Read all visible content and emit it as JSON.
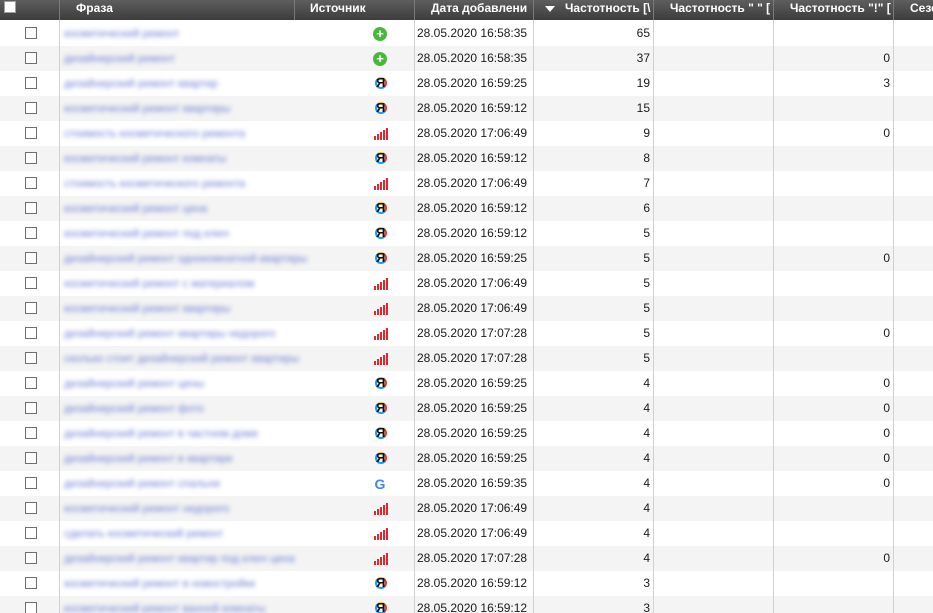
{
  "columns": {
    "phrase": "Фраза",
    "source": "Источник",
    "date_added": "Дата добавлени",
    "freq": "Частотность [\\",
    "freq_quotes": "Частотность \" \" [",
    "freq_excl": "Частотность \"!\" [",
    "season": "Сезо"
  },
  "sort_column": "freq",
  "rows": [
    {
      "phrase": "косметический ремонт",
      "source": "plus-icon",
      "date": "28.05.2020 16:58:35",
      "freq": "65",
      "freq_quotes": "",
      "freq_excl": ""
    },
    {
      "phrase": "дизайнерский ремонт",
      "source": "plus-icon",
      "date": "28.05.2020 16:58:35",
      "freq": "37",
      "freq_quotes": "",
      "freq_excl": "0"
    },
    {
      "phrase": "дизайнерский ремонт квартир",
      "source": "yandex-icon",
      "date": "28.05.2020 16:59:25",
      "freq": "19",
      "freq_quotes": "",
      "freq_excl": "3"
    },
    {
      "phrase": "косметический ремонт квартиры",
      "source": "yandex-icon",
      "date": "28.05.2020 16:59:12",
      "freq": "15",
      "freq_quotes": "",
      "freq_excl": ""
    },
    {
      "phrase": "стоимость косметического ремонта",
      "source": "wordstat-bars-icon",
      "date": "28.05.2020 17:06:49",
      "freq": "9",
      "freq_quotes": "",
      "freq_excl": "0"
    },
    {
      "phrase": "косметический ремонт комнаты",
      "source": "yandex-icon",
      "date": "28.05.2020 16:59:12",
      "freq": "8",
      "freq_quotes": "",
      "freq_excl": ""
    },
    {
      "phrase": "стоимость косметического ремонта",
      "source": "wordstat-bars-icon",
      "date": "28.05.2020 17:06:49",
      "freq": "7",
      "freq_quotes": "",
      "freq_excl": ""
    },
    {
      "phrase": "косметический ремонт цена",
      "source": "yandex-icon",
      "date": "28.05.2020 16:59:12",
      "freq": "6",
      "freq_quotes": "",
      "freq_excl": ""
    },
    {
      "phrase": "косметический ремонт под ключ",
      "source": "yandex-icon",
      "date": "28.05.2020 16:59:12",
      "freq": "5",
      "freq_quotes": "",
      "freq_excl": ""
    },
    {
      "phrase": "дизайнерский ремонт однокомнатной квартиры",
      "source": "yandex-icon",
      "date": "28.05.2020 16:59:25",
      "freq": "5",
      "freq_quotes": "",
      "freq_excl": "0"
    },
    {
      "phrase": "косметический ремонт с материалом",
      "source": "wordstat-bars-icon",
      "date": "28.05.2020 17:06:49",
      "freq": "5",
      "freq_quotes": "",
      "freq_excl": ""
    },
    {
      "phrase": "косметический ремонт квартиры",
      "source": "wordstat-bars-icon",
      "date": "28.05.2020 17:06:49",
      "freq": "5",
      "freq_quotes": "",
      "freq_excl": ""
    },
    {
      "phrase": "дизайнерский ремонт квартиры недорого",
      "source": "wordstat-bars-icon",
      "date": "28.05.2020 17:07:28",
      "freq": "5",
      "freq_quotes": "",
      "freq_excl": "0"
    },
    {
      "phrase": "сколько стоит дизайнерский ремонт квартиры",
      "source": "wordstat-bars-icon",
      "date": "28.05.2020 17:07:28",
      "freq": "5",
      "freq_quotes": "",
      "freq_excl": ""
    },
    {
      "phrase": "дизайнерский ремонт цены",
      "source": "yandex-icon",
      "date": "28.05.2020 16:59:25",
      "freq": "4",
      "freq_quotes": "",
      "freq_excl": "0"
    },
    {
      "phrase": "дизайнерский ремонт фото",
      "source": "yandex-icon",
      "date": "28.05.2020 16:59:25",
      "freq": "4",
      "freq_quotes": "",
      "freq_excl": "0"
    },
    {
      "phrase": "дизайнерский ремонт в частном доме",
      "source": "yandex-icon",
      "date": "28.05.2020 16:59:25",
      "freq": "4",
      "freq_quotes": "",
      "freq_excl": "0"
    },
    {
      "phrase": "дизайнерский ремонт в квартире",
      "source": "yandex-icon",
      "date": "28.05.2020 16:59:25",
      "freq": "4",
      "freq_quotes": "",
      "freq_excl": "0"
    },
    {
      "phrase": "дизайнерский ремонт спальни",
      "source": "google-icon",
      "date": "28.05.2020 16:59:35",
      "freq": "4",
      "freq_quotes": "",
      "freq_excl": "0"
    },
    {
      "phrase": "косметический ремонт недорого",
      "source": "wordstat-bars-icon",
      "date": "28.05.2020 17:06:49",
      "freq": "4",
      "freq_quotes": "",
      "freq_excl": ""
    },
    {
      "phrase": "сделать косметический ремонт",
      "source": "wordstat-bars-icon",
      "date": "28.05.2020 17:06:49",
      "freq": "4",
      "freq_quotes": "",
      "freq_excl": ""
    },
    {
      "phrase": "дизайнерский ремонт квартир под ключ цена",
      "source": "wordstat-bars-icon",
      "date": "28.05.2020 17:07:28",
      "freq": "4",
      "freq_quotes": "",
      "freq_excl": "0"
    },
    {
      "phrase": "косметический ремонт в новостройке",
      "source": "yandex-icon",
      "date": "28.05.2020 16:59:12",
      "freq": "3",
      "freq_quotes": "",
      "freq_excl": ""
    },
    {
      "phrase": "косметический ремонт ванной комнаты",
      "source": "yandex-icon",
      "date": "28.05.2020 16:59:12",
      "freq": "3",
      "freq_quotes": "",
      "freq_excl": ""
    }
  ]
}
